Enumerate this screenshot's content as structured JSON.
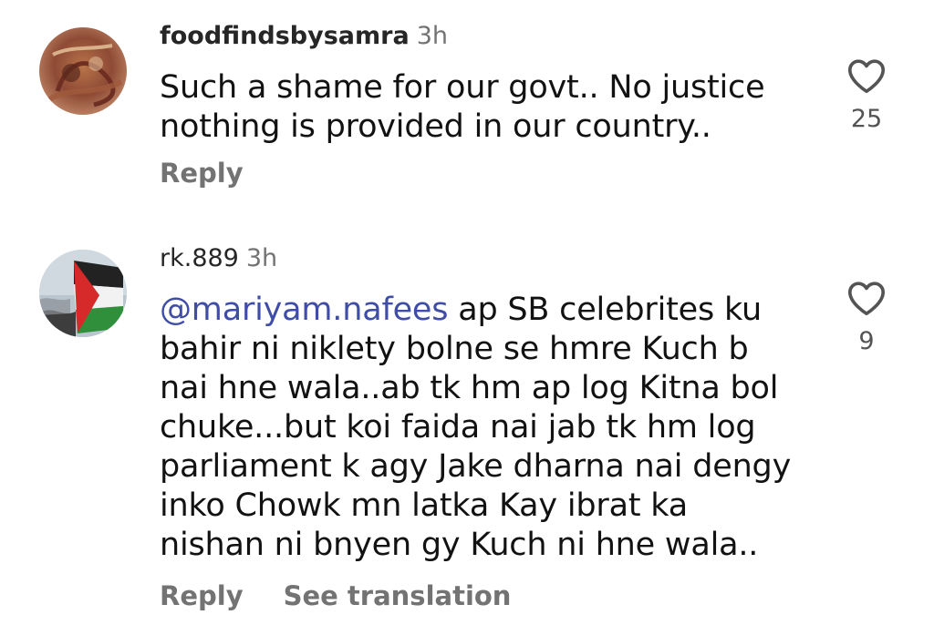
{
  "comments": [
    {
      "username": "foodfindsbysamra",
      "time": "3h",
      "mention": "",
      "text": "Such a shame for our govt.. No justice nothing is provided in our country..",
      "likes": "25",
      "reply_label": "Reply",
      "translate_label": ""
    },
    {
      "username": "rk.889",
      "time": "3h",
      "mention": "@mariyam.nafees",
      "text": " ap SB celebrites ku bahir ni niklety bolne se hmre Kuch b nai hne wala..ab tk hm ap log Kitna bol chuke...but koi faida nai jab tk hm log parliament k agy Jake dharna nai dengy inko Chowk mn latka Kay ibrat ka nishan ni bnyen gy Kuch ni hne wala..",
      "likes": "9",
      "reply_label": "Reply",
      "translate_label": "See translation"
    }
  ],
  "icons": {
    "like": "heart-outline-icon"
  },
  "colors": {
    "mention": "#3f4da6",
    "secondary_text": "#737373"
  }
}
